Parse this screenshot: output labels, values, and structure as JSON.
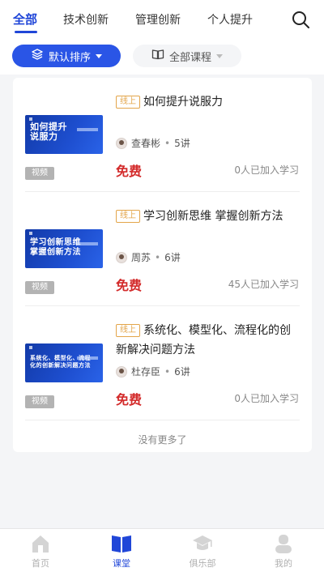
{
  "tabs": [
    {
      "label": "全部",
      "active": true
    },
    {
      "label": "技术创新",
      "active": false
    },
    {
      "label": "管理创新",
      "active": false
    },
    {
      "label": "个人提升",
      "active": false
    }
  ],
  "search_icon": "search-icon",
  "filters": {
    "sort_label": "默认排序",
    "course_label": "全部课程"
  },
  "courses": [
    {
      "tag": "线上",
      "title": "如何提升说服力",
      "thumb_title": "如何提升\n说服力",
      "teacher": "查春彬",
      "lessons": "5讲",
      "price": "免费",
      "joined": "0人已加入学习",
      "badge": "视频"
    },
    {
      "tag": "线上",
      "title": "学习创新思维 掌握创新方法",
      "thumb_title": "学习创新思维\n掌握创新方法",
      "teacher": "周苏",
      "lessons": "6讲",
      "price": "免费",
      "joined": "45人已加入学习",
      "badge": "视频"
    },
    {
      "tag": "线上",
      "title": "系统化、模型化、流程化的创新解决问题方法",
      "thumb_title": "系统化、模型化、流程\n化的创新解决问题方法",
      "teacher": "杜存臣",
      "lessons": "6讲",
      "price": "免费",
      "joined": "0人已加入学习",
      "badge": "视频"
    }
  ],
  "no_more": "没有更多了",
  "bottom_nav": [
    {
      "label": "首页",
      "icon": "home-icon",
      "active": false
    },
    {
      "label": "课堂",
      "icon": "book-icon",
      "active": true
    },
    {
      "label": "俱乐部",
      "icon": "graduation-cap-icon",
      "active": false
    },
    {
      "label": "我的",
      "icon": "user-icon",
      "active": false
    }
  ],
  "colors": {
    "accent": "#2046d8",
    "price": "#d32b2b",
    "tag": "#e3a54a"
  }
}
